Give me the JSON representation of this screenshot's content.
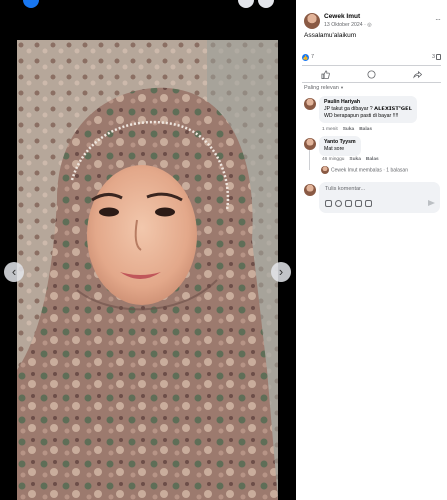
{
  "post": {
    "author": "Cewek Imut",
    "date": "13 Oktober 2024",
    "separator": " · ",
    "caption": "Assalamu'alaikum",
    "reaction_count": "7",
    "comment_count": "3"
  },
  "actions": {
    "like_icon": "thumbs-up-icon",
    "comment_icon": "comment-icon",
    "share_icon": "share-icon"
  },
  "sort": {
    "label": "Paling relevan",
    "chevron": "▾"
  },
  "comments": [
    {
      "author": "Paulin Hariyah",
      "line1": "JP takut ga dibayar ? 𝗔𝗟𝗘𝗫𝗜𝗦𝗧*𝗚𝗘𝗟",
      "line2": "WD berapapun pasti di bayar !!!!",
      "time": "1 menit",
      "like": "Suka",
      "reply": "Balas"
    },
    {
      "author": "Yanto Tyysm",
      "line1": "Mat sore",
      "time": "46 minggu",
      "like": "Suka",
      "reply": "Balas"
    }
  ],
  "replies_summary": "Cewek Imut membalas · 1 balasan",
  "composer": {
    "placeholder": "Tulis komentar..."
  },
  "viewer": {
    "prev": "‹",
    "next": "›"
  },
  "colors": {
    "accent": "#1877f2",
    "secondary_text": "#65676b",
    "bubble": "#f0f2f5"
  }
}
